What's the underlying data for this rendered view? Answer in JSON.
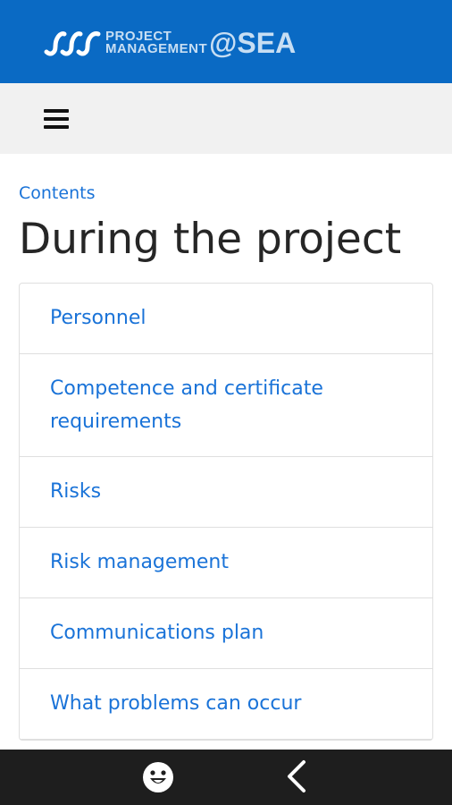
{
  "brand": {
    "line1": "PROJECT",
    "line2": "MANAGEMENT",
    "suffix": "@SEA",
    "color": "#0a6ac4"
  },
  "nav": {
    "menu_icon": "hamburger-menu-icon"
  },
  "breadcrumb": {
    "label": "Contents"
  },
  "page": {
    "title": "During the project"
  },
  "topics": [
    {
      "label": "Personnel"
    },
    {
      "label": "Competence and certificate requirements"
    },
    {
      "label": "Risks"
    },
    {
      "label": "Risk management"
    },
    {
      "label": "Communications plan"
    },
    {
      "label": "What problems can occur"
    }
  ],
  "system_bar": {
    "home_icon": "assistant-face-icon",
    "back_icon": "back-chevron-icon"
  },
  "colors": {
    "link": "#1a73d8",
    "nav_background": "#f1f1f1",
    "system_bar": "#1e1e1e"
  }
}
